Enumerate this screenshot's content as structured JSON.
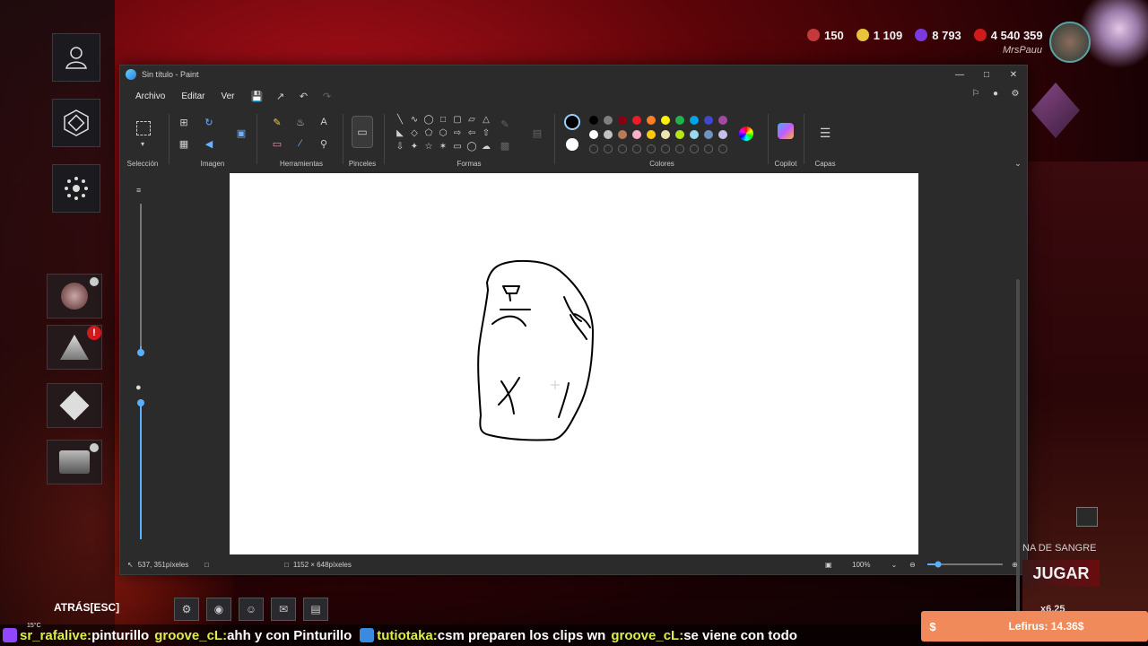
{
  "game": {
    "currencies": [
      {
        "value": "150",
        "color": "#c23a3a",
        "icon": "iridescent-shard-icon"
      },
      {
        "value": "1 109",
        "color": "#e8c23a",
        "icon": "auric-cell-icon"
      },
      {
        "value": "8 793",
        "color": "#7a3ae0",
        "icon": "rift-fragment-icon"
      },
      {
        "value": "4 540 359",
        "color": "#d21a1a",
        "icon": "bloodpoints-icon"
      }
    ],
    "player_name": "MrsPauu",
    "back_label": "ATRÁS",
    "back_key": "[ESC]",
    "play_label": "JUGAR",
    "blood_label": "NA DE SANGRE",
    "partial_value": "x6.25"
  },
  "paint": {
    "title": "Sin título - Paint",
    "menu": [
      "Archivo",
      "Editar",
      "Ver"
    ],
    "groups": {
      "selection": "Selección",
      "image": "Imagen",
      "tools": "Herramientas",
      "brushes": "Pinceles",
      "shapes": "Formas",
      "colors": "Colores",
      "copilot": "Copilot",
      "layers": "Capas"
    },
    "palette_row1": [
      "#000000",
      "#7f7f7f",
      "#880015",
      "#ed1c24",
      "#ff7f27",
      "#fff200",
      "#22b14c",
      "#00a2e8",
      "#3f48cc",
      "#a349a4"
    ],
    "palette_row2": [
      "#ffffff",
      "#c3c3c3",
      "#b97a57",
      "#ffaec9",
      "#ffc90e",
      "#efe4b0",
      "#b5e61d",
      "#99d9ea",
      "#7092be",
      "#c8bfe7"
    ],
    "status": {
      "cursor": "537, 351píxeles",
      "canvas_size": "1152 × 648píxeles",
      "zoom": "100%"
    }
  },
  "ticker": [
    {
      "user": "sr_rafalive:",
      "msg": "pinturillo"
    },
    {
      "user": "groove_cL:",
      "msg": "ahh y con Pinturillo"
    },
    {
      "user": "tutiotaka:",
      "msg": "csm preparen los clips wn"
    },
    {
      "user": "groove_cL:",
      "msg": "se viene con todo"
    }
  ],
  "weather": "15°C",
  "donation": {
    "currency": "$",
    "text": "Lefirus: 14.36$"
  }
}
